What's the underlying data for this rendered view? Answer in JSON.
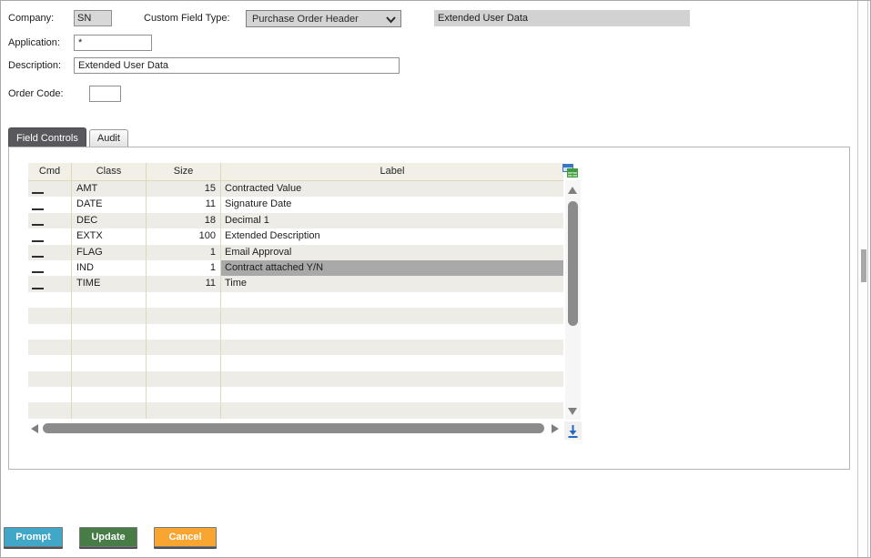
{
  "form": {
    "company_label": "Company:",
    "company_value": "SN",
    "custom_field_type_label": "Custom Field Type:",
    "custom_field_type_value": "Purchase Order Header",
    "custom_field_type_display": "Extended User Data",
    "application_label": "Application:",
    "application_value": "*",
    "description_label": "Description:",
    "description_value": "Extended User Data",
    "order_code_label": "Order Code:",
    "order_code_value": ""
  },
  "tabs": {
    "field_controls": "Field Controls",
    "audit": "Audit",
    "active_tab": "Field Controls"
  },
  "grid": {
    "columns": {
      "cmd": "Cmd",
      "class": "Class",
      "size": "Size",
      "label": "Label"
    },
    "rows": [
      {
        "cmd": "__",
        "class": "AMT",
        "size": "15",
        "label": "Contracted Value",
        "highlighted": false
      },
      {
        "cmd": "__",
        "class": "DATE",
        "size": "11",
        "label": "Signature Date",
        "highlighted": false
      },
      {
        "cmd": "__",
        "class": "DEC",
        "size": "18",
        "label": "Decimal 1",
        "highlighted": false
      },
      {
        "cmd": "__",
        "class": "EXTX",
        "size": "100",
        "label": "Extended Description",
        "highlighted": false
      },
      {
        "cmd": "__",
        "class": "FLAG",
        "size": "1",
        "label": "Email Approval",
        "highlighted": false
      },
      {
        "cmd": "__",
        "class": "IND",
        "size": "1",
        "label": "Contract attached Y/N",
        "highlighted": true
      },
      {
        "cmd": "__",
        "class": "TIME",
        "size": "11",
        "label": "Time",
        "highlighted": false
      }
    ],
    "empty_rows": 8
  },
  "buttons": {
    "prompt": "Prompt",
    "update": "Update",
    "cancel": "Cancel"
  },
  "colors": {
    "prompt_bg": "#41a7c9",
    "update_bg": "#477c46",
    "cancel_bg": "#f8a532",
    "active_tab_bg": "#59585d",
    "selected_cell_bg": "#a9a9a9",
    "row_stripe_bg": "#edece7",
    "header_bg": "#f2f0e6",
    "grid_border": "#ddd8c0",
    "readonly_field_bg": "#d4d4d4"
  },
  "icons": {
    "dropdown_chevron": "chevron-down",
    "grid_button": "grid-table",
    "scroll_to_bottom": "arrow-down-to-bar",
    "vertical_scroll": "up/down triangles",
    "horizontal_scroll": "left/right triangles"
  }
}
